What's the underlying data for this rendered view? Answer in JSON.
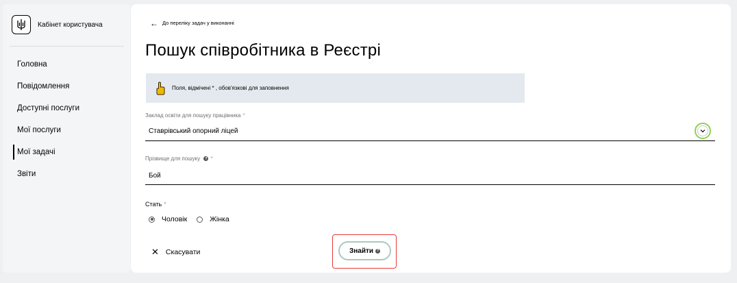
{
  "sidebar": {
    "brand_title": "Кабінет користувача",
    "items": [
      {
        "label": "Головна"
      },
      {
        "label": "Повідомлення"
      },
      {
        "label": "Доступні послуги"
      },
      {
        "label": "Мої послуги"
      },
      {
        "label": "Мої задачі",
        "active": true
      },
      {
        "label": "Звіти"
      }
    ]
  },
  "main": {
    "back_link": "До переліку задач у виконанні",
    "title": "Пошук співробітника в Реєстрі",
    "notice": "Поля, відмічені * , обов'язкові для заповнення",
    "institution": {
      "label": "Заклад освіти для пошуку працівника",
      "required_mark": "*",
      "value": "Ставрівський опорний ліцей"
    },
    "surname": {
      "label": "Прізвище для пошуку",
      "required_mark": "*",
      "value": "Бой"
    },
    "gender": {
      "label": "Стать",
      "required_mark": "*",
      "options": [
        {
          "label": "Чоловік",
          "selected": true
        },
        {
          "label": "Жінка",
          "selected": false
        }
      ]
    },
    "cancel_label": "Скасувати",
    "search_label": "Знайти",
    "info_glyph": "?"
  },
  "colors": {
    "page_bg": "#eef0f1",
    "sidebar_bg": "#f4f5f6",
    "notice_bg": "#e3e9ee",
    "highlight_green": "#8fd14f",
    "highlight_red": "#e53935",
    "search_border": "#aac8c2"
  },
  "icons": {
    "brand": "trident-emblem-icon",
    "notice": "pointing-hand-icon",
    "back": "arrow-left-icon",
    "dropdown": "chevron-down-icon",
    "cancel": "close-icon",
    "info": "question-circle-icon"
  }
}
